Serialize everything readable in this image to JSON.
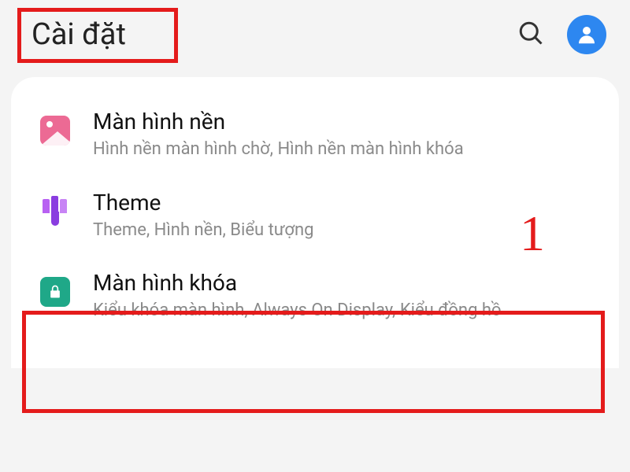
{
  "header": {
    "title": "Cài đặt"
  },
  "items": [
    {
      "title": "Màn hình nền",
      "subtitle": "Hình nền màn hình chờ, Hình nền màn hình khóa",
      "icon": "wallpaper-icon"
    },
    {
      "title": "Theme",
      "subtitle": "Theme, Hình nền, Biểu tượng",
      "icon": "theme-icon"
    },
    {
      "title": "Màn hình khóa",
      "subtitle": "Kiểu khóa màn hình, Always On Display, Kiểu đồng hồ",
      "icon": "lock-icon"
    }
  ],
  "annotation": {
    "step": "1"
  }
}
